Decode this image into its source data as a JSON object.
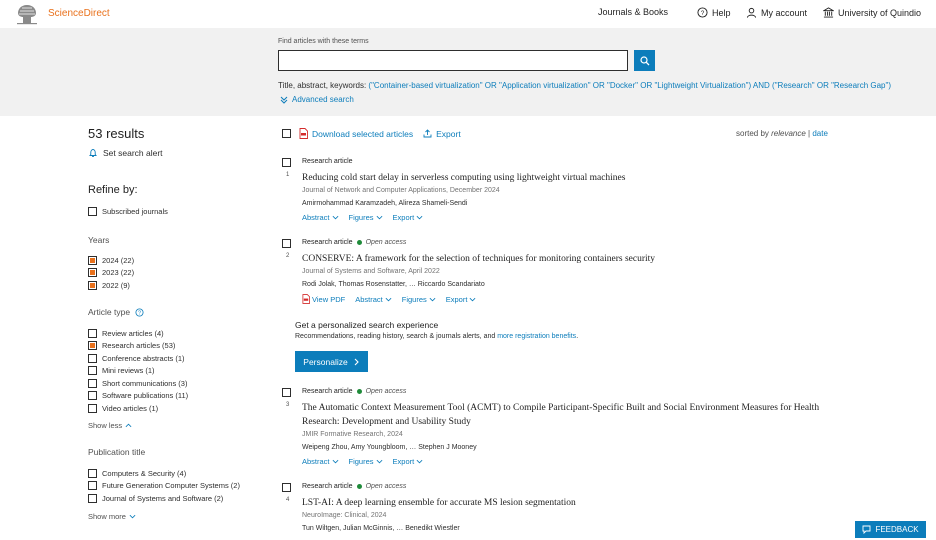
{
  "header": {
    "brand": "ScienceDirect",
    "journals_books": "Journals & Books",
    "help": "Help",
    "my_account": "My account",
    "institution": "University of Quindio"
  },
  "search": {
    "label": "Find articles with these terms",
    "value": "",
    "query_prefix": "Title, abstract, keywords: ",
    "query_terms": "(\"Container-based virtualization\" OR \"Application virtualization\" OR \"Docker\" OR \"Lightweight Virtualization\") AND (\"Research\" OR \"Research Gap\")",
    "advanced": "Advanced search"
  },
  "sidebar": {
    "results_count": "53 results",
    "set_alert": "Set search alert",
    "refine_by": "Refine by:",
    "subscribed": "Subscribed journals",
    "years_title": "Years",
    "years": [
      {
        "label": "2024 (22)",
        "checked": true
      },
      {
        "label": "2023 (22)",
        "checked": true
      },
      {
        "label": "2022 (9)",
        "checked": true
      }
    ],
    "article_type_title": "Article type",
    "article_types": [
      {
        "label": "Review articles (4)",
        "checked": false
      },
      {
        "label": "Research articles (53)",
        "checked": true
      },
      {
        "label": "Conference abstracts (1)",
        "checked": false
      },
      {
        "label": "Mini reviews (1)",
        "checked": false
      },
      {
        "label": "Short communications (3)",
        "checked": false
      },
      {
        "label": "Software publications (11)",
        "checked": false
      },
      {
        "label": "Video articles (1)",
        "checked": false
      }
    ],
    "show_less": "Show less",
    "publication_title": "Publication title",
    "publications": [
      {
        "label": "Computers & Security (4)",
        "checked": false
      },
      {
        "label": "Future Generation Computer Systems (2)",
        "checked": false
      },
      {
        "label": "Journal of Systems and Software (2)",
        "checked": false
      }
    ],
    "show_more": "Show more"
  },
  "toolbar": {
    "download": "Download selected articles",
    "export": "Export",
    "sorted_by": "sorted by ",
    "relevance": "relevance",
    "separator": " | ",
    "date": "date"
  },
  "results": [
    {
      "num": "1",
      "type": "Research article",
      "open_access": "",
      "title": "Reducing cold start delay in serverless computing using lightweight virtual machines",
      "journal": "Journal of Network and Computer Applications, December 2024",
      "authors": "Amirmohammad Karamzadeh, Alireza Shameli-Sendi",
      "actions": [
        "Abstract",
        "Figures",
        "Export"
      ]
    },
    {
      "num": "2",
      "type": "Research article",
      "open_access": "Open access",
      "title": "CONSERVE: A framework for the selection of techniques for monitoring containers security",
      "journal": "Journal of Systems and Software, April 2022",
      "authors": "Rodi Jolak, Thomas Rosenstatter, … Riccardo Scandariato",
      "actions": [
        "View PDF",
        "Abstract",
        "Figures",
        "Export"
      ]
    },
    {
      "num": "3",
      "type": "Research article",
      "open_access": "Open access",
      "title": "The Automatic Context Measurement Tool (ACMT) to Compile Participant-Specific Built and Social Environment Measures for Health Research: Development and Usability Study",
      "journal": "JMIR Formative Research, 2024",
      "authors": "Weipeng Zhou, Amy Youngbloom, … Stephen J Mooney",
      "actions": [
        "Abstract",
        "Figures",
        "Export"
      ]
    },
    {
      "num": "4",
      "type": "Research article",
      "open_access": "Open access",
      "title": "LST-AI: A deep learning ensemble for accurate MS lesion segmentation",
      "journal": "NeuroImage: Clinical, 2024",
      "authors": "Tun Wiltgen, Julian McGinnis, … Benedikt Wiestler",
      "actions": []
    }
  ],
  "promo": {
    "title": "Get a personalized search experience",
    "text": "Recommendations, reading history, search & journals alerts, and ",
    "link": "more registration benefits",
    "text_end": ".",
    "button": "Personalize"
  },
  "feedback": "FEEDBACK",
  "colors": {
    "accent": "#0c7dbb",
    "brand": "#e9711c",
    "open_access_dot": "#1f8b3a"
  }
}
